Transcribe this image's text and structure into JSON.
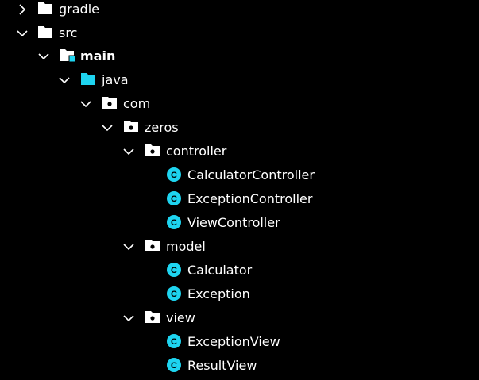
{
  "colors": {
    "background": "#000000",
    "text": "#ffffff",
    "accent": "#1ed4f0"
  },
  "tree": [
    {
      "label": "gradle",
      "icon": "folder-icon",
      "chevron": "chevron-right-icon"
    },
    {
      "label": "src",
      "icon": "folder-icon",
      "chevron": "chevron-down-icon"
    },
    {
      "label": "main",
      "icon": "source-root-folder-icon",
      "chevron": "chevron-down-icon"
    },
    {
      "label": "java",
      "icon": "source-folder-icon",
      "chevron": "chevron-down-icon"
    },
    {
      "label": "com",
      "icon": "package-folder-icon",
      "chevron": "chevron-down-icon"
    },
    {
      "label": "zeros",
      "icon": "package-folder-icon",
      "chevron": "chevron-down-icon"
    },
    {
      "label": "controller",
      "icon": "package-folder-icon",
      "chevron": "chevron-down-icon"
    },
    {
      "label": "CalculatorController",
      "icon": "class-icon",
      "badge": "C"
    },
    {
      "label": "ExceptionController",
      "icon": "class-icon",
      "badge": "C"
    },
    {
      "label": "ViewController",
      "icon": "class-icon",
      "badge": "C"
    },
    {
      "label": "model",
      "icon": "package-folder-icon",
      "chevron": "chevron-down-icon"
    },
    {
      "label": "Calculator",
      "icon": "class-icon",
      "badge": "C"
    },
    {
      "label": "Exception",
      "icon": "class-icon",
      "badge": "C"
    },
    {
      "label": "view",
      "icon": "package-folder-icon",
      "chevron": "chevron-down-icon"
    },
    {
      "label": "ExceptionView",
      "icon": "class-icon",
      "badge": "C"
    },
    {
      "label": "ResultView",
      "icon": "class-icon",
      "badge": "C"
    }
  ]
}
